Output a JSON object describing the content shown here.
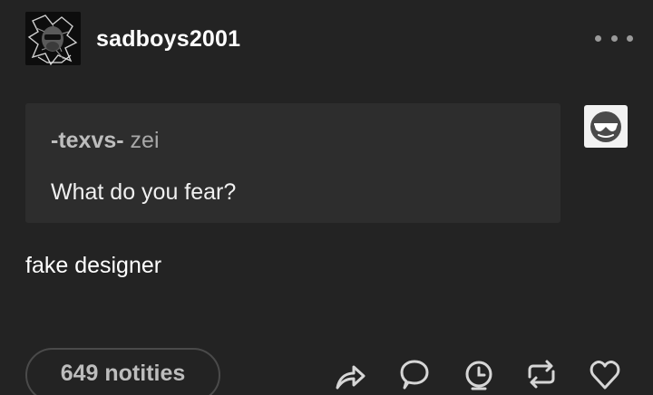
{
  "post": {
    "username": "sadboys2001",
    "more_icon": "ellipsis-icon"
  },
  "ask": {
    "asker_name": "-texvs-",
    "asker_verb": "zei",
    "question": "What do you fear?",
    "asker_avatar_icon": "sunglasses-face-icon"
  },
  "answer": {
    "text": "fake designer"
  },
  "footer": {
    "notes_label": "649 notities",
    "actions": [
      "share-icon",
      "reply-icon",
      "schedule-icon",
      "reblog-icon",
      "like-icon"
    ]
  },
  "colors": {
    "background": "#232323",
    "ask_background": "#2d2d2d",
    "text_primary": "#ffffff",
    "text_muted": "#a8a8a8"
  }
}
